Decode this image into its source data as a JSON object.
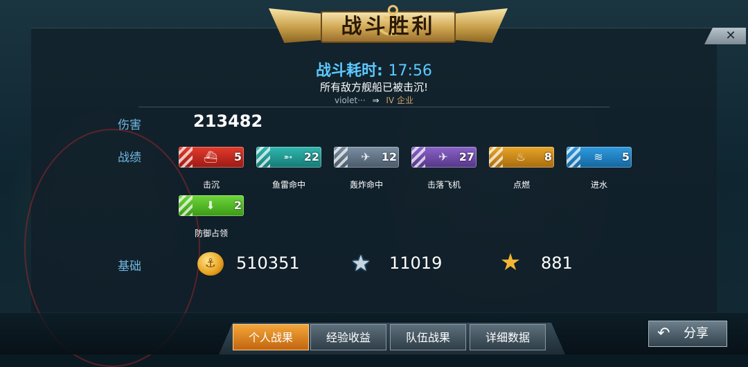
{
  "banner": {
    "title": "战斗胜利"
  },
  "close": {
    "glyph": "✕"
  },
  "battle": {
    "time_label": "战斗耗时:",
    "time_value": "17:56",
    "result_text": "所有敌方舰船已被击沉!",
    "player_name": "violet···",
    "rank": "IV",
    "ship_name": "企业"
  },
  "labels": {
    "damage": "伤害",
    "record": "战绩",
    "base": "基础"
  },
  "damage_value": "213482",
  "medals": [
    {
      "label": "击沉",
      "count": "5",
      "color_top": "#e43b2b",
      "color_bottom": "#9c1a14",
      "icon": "ship-icon"
    },
    {
      "label": "鱼雷命中",
      "count": "22",
      "color_top": "#2fb8b0",
      "color_bottom": "#167a74",
      "icon": "torpedo-icon"
    },
    {
      "label": "轰炸命中",
      "count": "12",
      "color_top": "#7b8fa3",
      "color_bottom": "#4a5a6a",
      "icon": "bomb-icon"
    },
    {
      "label": "击落飞机",
      "count": "27",
      "color_top": "#8b63c9",
      "color_bottom": "#553687",
      "icon": "plane-icon"
    },
    {
      "label": "点燃",
      "count": "8",
      "color_top": "#e8a62a",
      "color_bottom": "#a86b0c",
      "icon": "fire-icon"
    },
    {
      "label": "进水",
      "count": "5",
      "color_top": "#2f9be0",
      "color_bottom": "#14669e",
      "icon": "flood-icon"
    },
    {
      "label": "防御占领",
      "count": "2",
      "color_top": "#6fd63b",
      "color_bottom": "#3b9a16",
      "icon": "defense-icon"
    }
  ],
  "base": {
    "gold": "510351",
    "exp": "11019",
    "captain_exp": "881"
  },
  "tabs": [
    {
      "label": "个人战果",
      "active": true
    },
    {
      "label": "经验收益",
      "active": false
    },
    {
      "label": "队伍战果",
      "active": false
    },
    {
      "label": "详细数据",
      "active": false
    }
  ],
  "share": {
    "label": "分享"
  }
}
